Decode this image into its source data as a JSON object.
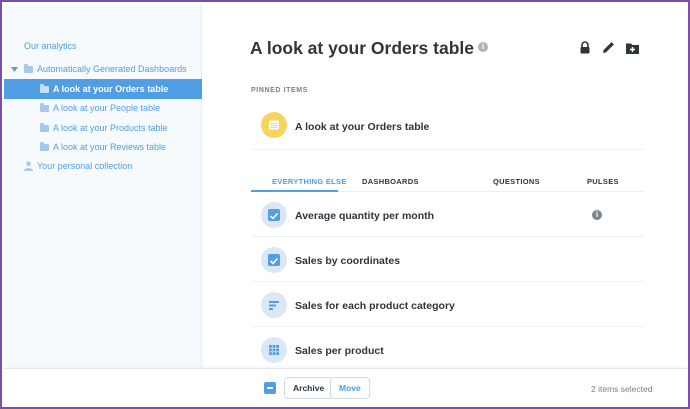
{
  "sidebar": {
    "items": [
      {
        "label": "Our analytics",
        "kind": "root"
      },
      {
        "label": "Automatically Generated Dashboards",
        "kind": "folder-open"
      },
      {
        "label": "A look at your Orders table",
        "kind": "folder",
        "active": true
      },
      {
        "label": "A look at your People table",
        "kind": "folder"
      },
      {
        "label": "A look at your Products table",
        "kind": "folder"
      },
      {
        "label": "A look at your Reviews table",
        "kind": "folder"
      },
      {
        "label": "Your personal collection",
        "kind": "person"
      }
    ]
  },
  "header": {
    "title": "A look at your Orders table",
    "title_info_icon": "info-icon",
    "actions": [
      "lock-icon",
      "pencil-icon",
      "add-folder-icon"
    ]
  },
  "pinned": {
    "section_label": "PINNED ITEMS",
    "item": {
      "label": "A look at your Orders table",
      "icon": "dashboard-icon",
      "icon_color": "#F9D45C"
    }
  },
  "tabs": [
    {
      "label": "EVERYTHING ELSE",
      "active": true
    },
    {
      "label": "DASHBOARDS"
    },
    {
      "label": "QUESTIONS"
    },
    {
      "label": "PULSES"
    }
  ],
  "items": [
    {
      "label": "Average quantity per month",
      "icon": "checked-checkbox",
      "has_info": true
    },
    {
      "label": "Sales by coordinates",
      "icon": "checked-checkbox"
    },
    {
      "label": "Sales for each product category",
      "icon": "bar-chart-icon"
    },
    {
      "label": "Sales per product",
      "icon": "grid-table-icon"
    }
  ],
  "bulk_bar": {
    "archive_label": "Archive",
    "move_label": "Move",
    "selected_text": "2 items selected"
  },
  "colors": {
    "accent": "#509EE3",
    "frame": "#7B4FA6"
  }
}
